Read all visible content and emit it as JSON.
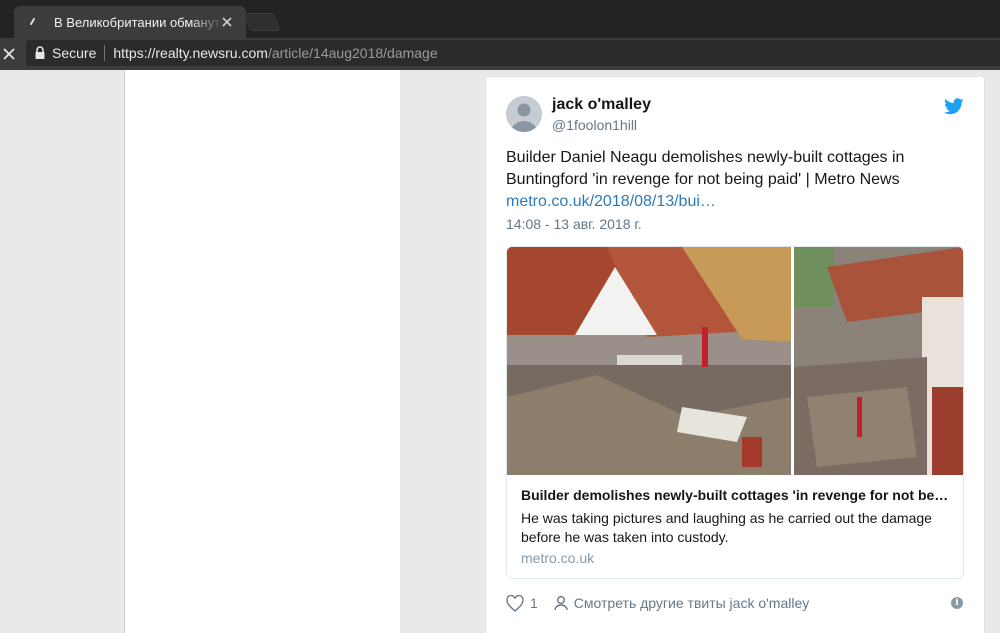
{
  "browser": {
    "tab_title": "В Великобритании обмануты",
    "secure_label": "Secure",
    "url_scheme_host": "https://realty.newsru.com",
    "url_path": "/article/14aug2018/damage"
  },
  "tweet": {
    "author_name": "jack o'malley",
    "author_handle": "@1foolon1hill",
    "text": "Builder Daniel Neagu demolishes newly-built cottages in Buntingford 'in revenge for not being paid' | Metro News",
    "link": "metro.co.uk/2018/08/13/bui…",
    "timestamp": "14:08 - 13 авг. 2018 г.",
    "card": {
      "title": "Builder demolishes newly-built cottages 'in revenge for not be…",
      "description": "He was taking pictures and laughing as he carried out the damage before he was taken into custody.",
      "domain": "metro.co.uk"
    },
    "like_count": "1",
    "more_tweets_label": "Смотреть другие твиты jack o'malley"
  },
  "colors": {
    "link": "#2b7bb9",
    "twitter_blue": "#1da1f2",
    "chrome_dark": "#222324"
  },
  "icons": [
    "favicon-icon",
    "close-icon",
    "stop-icon",
    "lock-icon",
    "twitter-bird-icon",
    "heart-icon",
    "person-icon",
    "info-icon"
  ]
}
